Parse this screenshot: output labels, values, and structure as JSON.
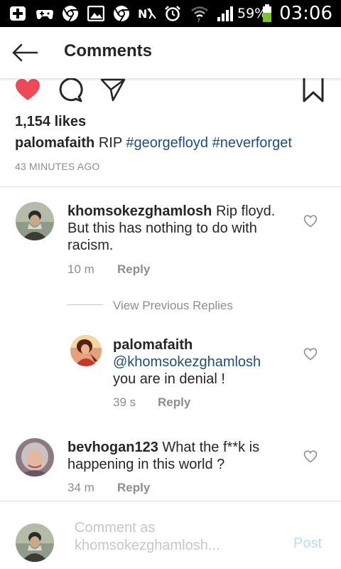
{
  "status_bar": {
    "battery": "59%",
    "time": "03:06"
  },
  "header": {
    "title": "Comments"
  },
  "post": {
    "likes": "1,154 likes",
    "caption_user": "palomafaith",
    "caption_text": "RIP",
    "hashtags": [
      "#georgefloyd",
      "#neverforget"
    ],
    "time": "43 MINUTES AGO"
  },
  "comments": [
    {
      "user": "khomsokezghamlosh",
      "text_line1": "Rip floyd.",
      "text_line2": "But this has nothing to do with",
      "text_line3": "racism.",
      "time": "10 m",
      "reply": "Reply"
    },
    {
      "view_previous": "View Previous Replies"
    },
    {
      "user": "palomafaith",
      "mention": "@khomsokezghamlosh",
      "text": "you are in denial !",
      "time": "39 s",
      "reply": "Reply"
    },
    {
      "user": "bevhogan123",
      "text_line1": "What the f**k is",
      "text_line2": "happening in this world ?",
      "time": "34 m",
      "reply": "Reply"
    }
  ],
  "composer": {
    "placeholder_line1": "Comment as",
    "placeholder_line2": "khomsokezghamlosh...",
    "post_label": "Post"
  },
  "colors": {
    "like_heart": "#ed4956",
    "link": "#1e4f7a",
    "post_button_disabled": "#b2dffc",
    "muted": "#8e8e8e"
  },
  "icons": [
    "back-arrow-icon",
    "heart-filled-icon",
    "comment-bubble-icon",
    "share-send-icon",
    "bookmark-icon",
    "heart-outline-icon"
  ]
}
